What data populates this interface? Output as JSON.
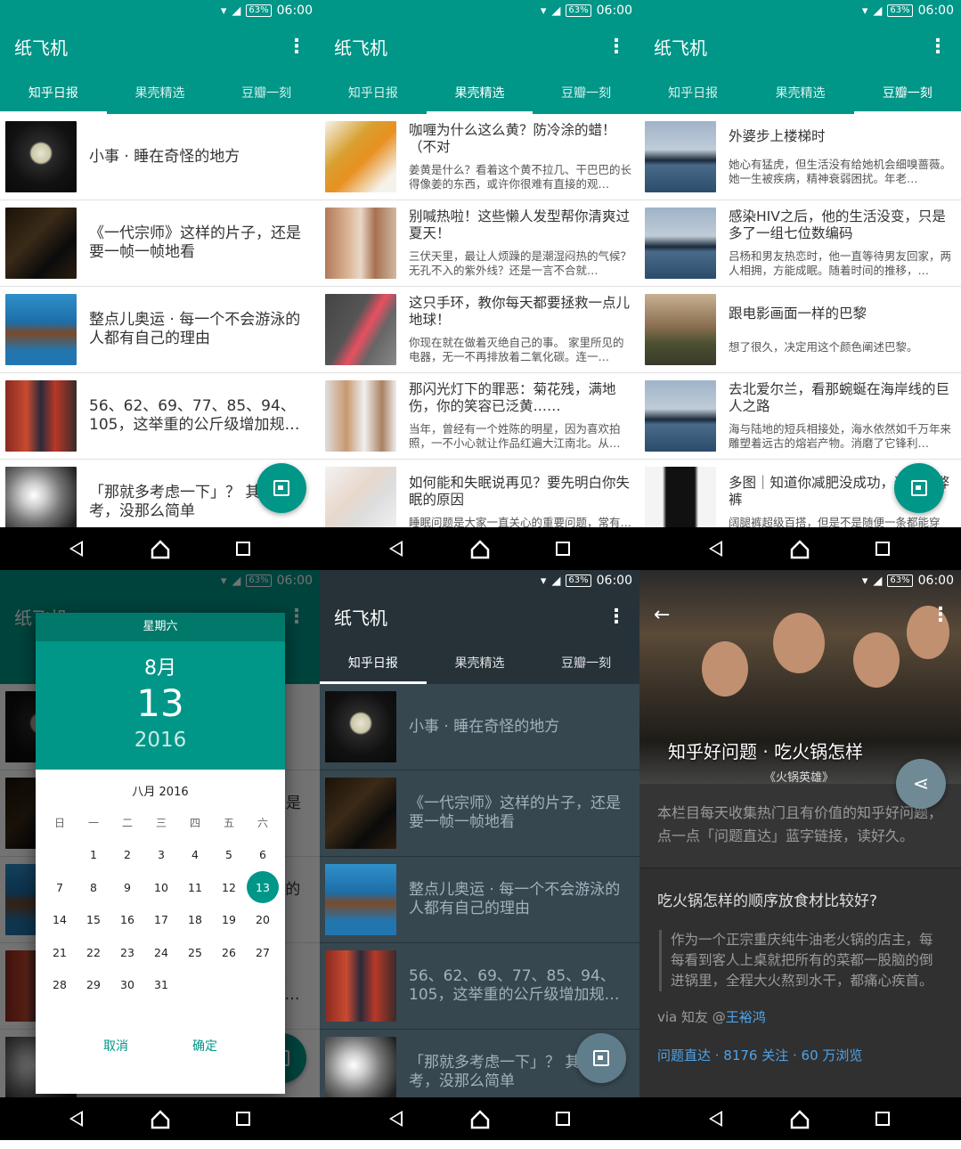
{
  "status": {
    "battery": "63%",
    "time": "06:00"
  },
  "app_title": "纸飞机",
  "tabs": [
    "知乎日报",
    "果壳精选",
    "豆瓣一刻"
  ],
  "zhihu_items": [
    {
      "title": "小事 · 睡在奇怪的地方",
      "thumb": "moon"
    },
    {
      "title": "《一代宗师》这样的片子，还是要一帧一帧地看",
      "thumb": "film"
    },
    {
      "title": "整点儿奥运 · 每一个不会游泳的人都有自己的理由",
      "thumb": "swim"
    },
    {
      "title": "56、62、69、77、85、94、105，这举重的公斤级增加规…",
      "thumb": "lift"
    },
    {
      "title": "「那就多考虑一下」？ 其实思考，没那么简单",
      "thumb": "brain"
    }
  ],
  "guokr_items": [
    {
      "title": "咖喱为什么这么黄？防冷涂的蜡！（不对",
      "desc": "姜黄是什么？看着这个黄不拉几、干巴巴的长得像姜的东西，或许你很难有直接的观…",
      "thumb": "turm"
    },
    {
      "title": "别喊热啦！这些懒人发型帮你清爽过夏天！",
      "desc": "三伏天里，最让人烦躁的是潮湿闷热的气候？无孔不入的紫外线？还是一言不合就…",
      "thumb": "face"
    },
    {
      "title": "这只手环，教你每天都要拯救一点儿地球！",
      "desc": "你现在就在做着灭绝自己的事。 家里所见的电器，无一不再排放着二氧化碳。连一…",
      "thumb": "phone"
    },
    {
      "title": "那闪光灯下的罪恶：菊花残，满地伤，你的笑容已泛黄……",
      "desc": "当年，曾经有一个姓陈的明星，因为喜欢拍照，一不小心就让作品红遍大江南北。从…",
      "thumb": "studio"
    },
    {
      "title": "如何能和失眠说再见？要先明白你失眠的原因",
      "desc": "睡眠问题是大家一直关心的重要问题，常有…",
      "thumb": "sleep"
    }
  ],
  "douban_items": [
    {
      "title": "外婆步上楼梯时",
      "desc": "她心有猛虎，但生活没有给她机会细嗅蔷薇。她一生被疾病，精神衰弱困扰。年老…",
      "thumb": "sea"
    },
    {
      "title": "感染HIV之后，他的生活没变，只是多了一组七位数编码",
      "desc": "吕杨和男友热恋时，他一直等待男友回家，两人相拥，方能成眠。随着时间的推移，…",
      "thumb": "sea"
    },
    {
      "title": "跟电影画面一样的巴黎",
      "desc": "想了很久，决定用这个颜色阐述巴黎。",
      "thumb": "paris"
    },
    {
      "title": "去北爱尔兰，看那蜿蜒在海岸线的巨人之路",
      "desc": "海与陆地的短兵相接处，海水依然如千万年来雕塑着远古的熔岩产物。消磨了它锋利…",
      "thumb": "sea"
    },
    {
      "title": "多图｜知道你减肥没成功，这条作弊裤",
      "desc": "阔腿裤超级百搭，但是不是随便一条都能穿",
      "thumb": "legs"
    }
  ],
  "date_picker": {
    "weekday": "星期六",
    "month": "8月",
    "day": "13",
    "year": "2016",
    "calendar_title": "八月 2016",
    "week_headers": [
      "日",
      "一",
      "二",
      "三",
      "四",
      "五",
      "六"
    ],
    "selected_day": 13,
    "cancel": "取消",
    "ok": "确定"
  },
  "article": {
    "title": "知乎好问题 · 吃火锅怎样",
    "caption": "《火锅英雄》",
    "intro": "本栏目每天收集热门且有价值的知乎好问题，点一点「问题直达」蓝字链接，读好久。",
    "question": "吃火锅怎样的顺序放食材比较好?",
    "answer": "作为一个正宗重庆纯牛油老火锅的店主，每每看到客人上桌就把所有的菜都一股脑的倒进锅里，全程大火熬到水干，都痛心疾首。",
    "via_prefix": "via 知友 @",
    "via_user": "王裕鸿",
    "link": "问题直达 · 8176 关注 · 60 万浏览"
  },
  "colors": {
    "primary": "#009688",
    "primary_dark": "#00796b",
    "night_bg": "#37474f",
    "night_bar": "#263238"
  }
}
